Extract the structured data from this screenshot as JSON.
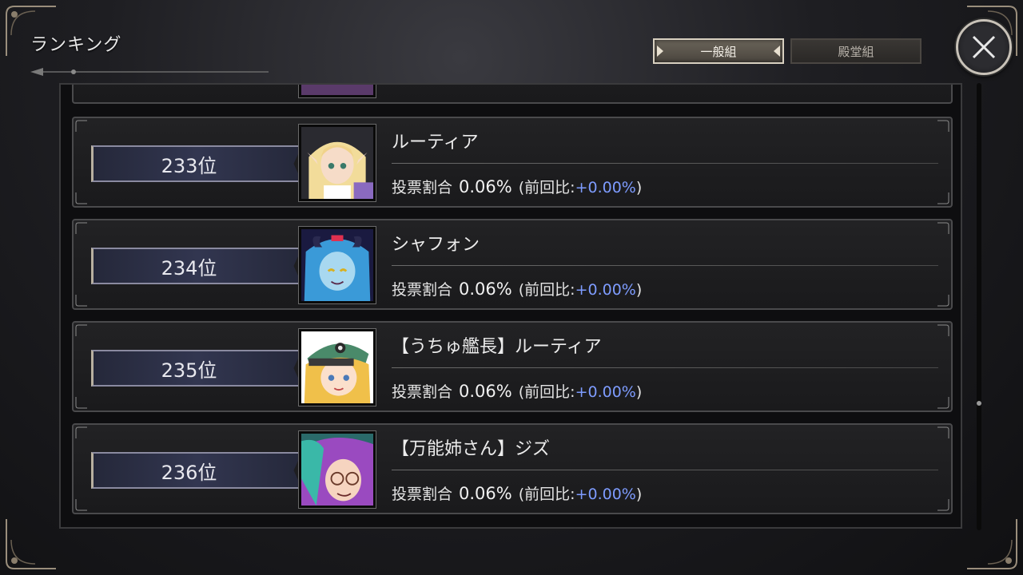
{
  "header": {
    "title": "ランキング",
    "tabs": [
      {
        "label": "一般組",
        "active": true
      },
      {
        "label": "殿堂組",
        "active": false
      }
    ]
  },
  "labels": {
    "vote_share": "投票割合",
    "prev_prefix": "(前回比:",
    "prev_suffix": ")"
  },
  "colors": {
    "delta": "#7e9cff",
    "accent_frame": "#c8c2b8"
  },
  "rankings": [
    {
      "rank": "233位",
      "name": "ルーティア",
      "share": "0.06%",
      "delta": "+0.00%",
      "portrait": "elf-blonde-portrait"
    },
    {
      "rank": "234位",
      "name": "シャフォン",
      "share": "0.06%",
      "delta": "+0.00%",
      "portrait": "blue-demon-portrait"
    },
    {
      "rank": "235位",
      "name": "【うちゅ艦長】ルーティア",
      "share": "0.06%",
      "delta": "+0.00%",
      "portrait": "captain-portrait"
    },
    {
      "rank": "236位",
      "name": "【万能姉さん】ジズ",
      "share": "0.06%",
      "delta": "+0.00%",
      "portrait": "glasses-portrait"
    }
  ]
}
